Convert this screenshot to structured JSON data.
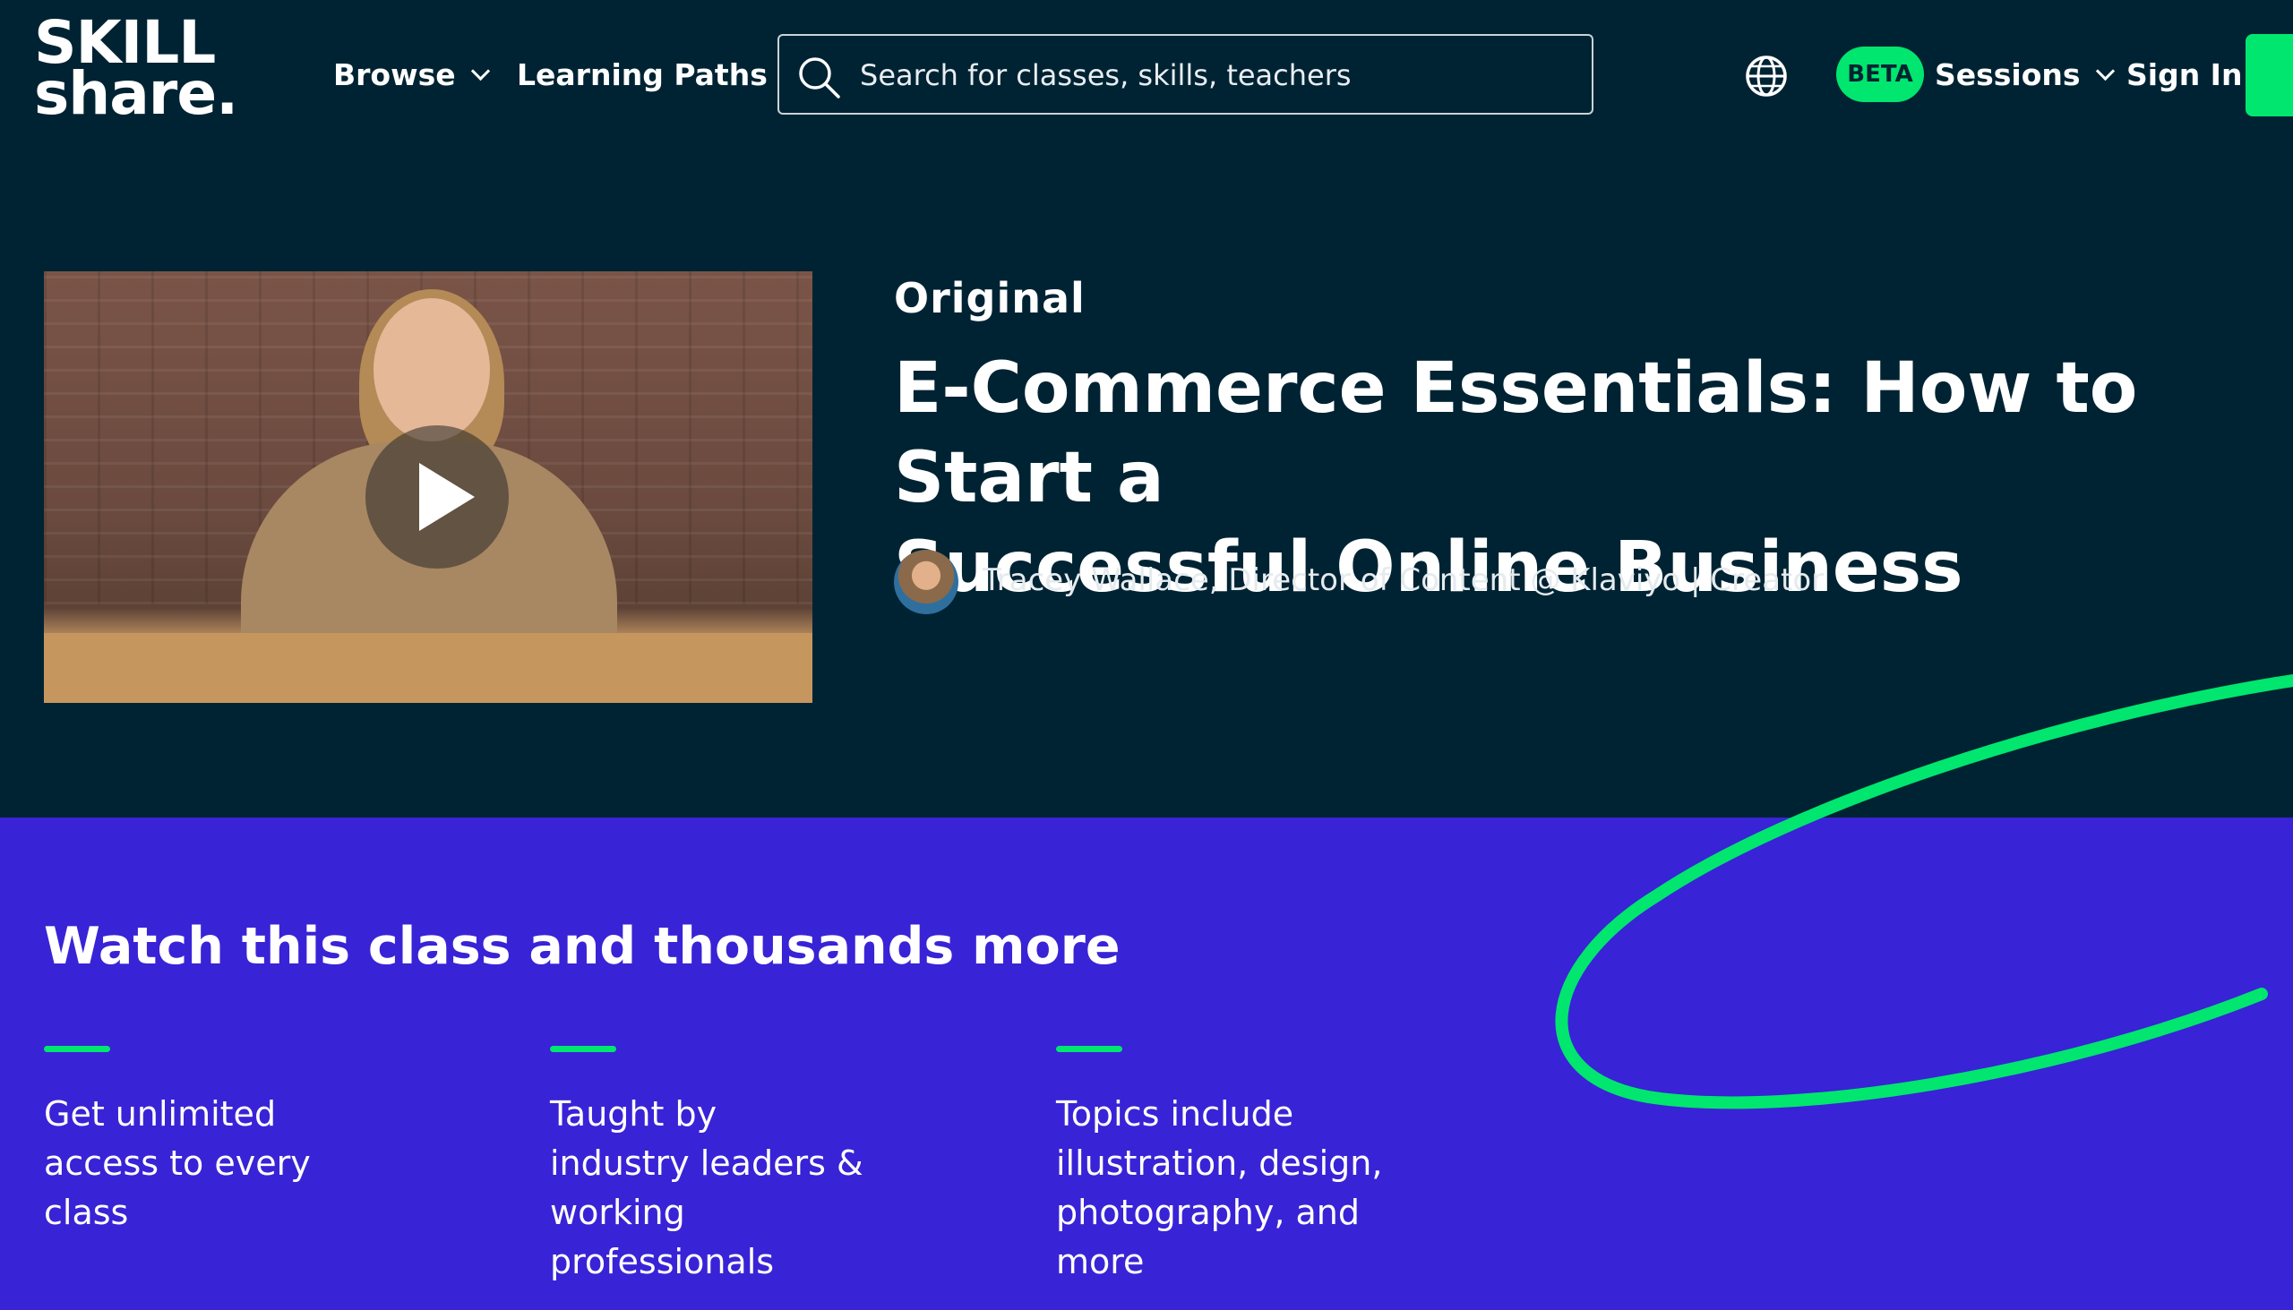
{
  "header": {
    "logo_line1": "SKILL",
    "logo_line2": "share.",
    "browse_label": "Browse",
    "learning_paths_label": "Learning Paths",
    "search_placeholder": "Search for classes, skills, teachers",
    "beta_badge": "BETA",
    "sessions_label": "Sessions",
    "sign_in_label": "Sign In"
  },
  "hero": {
    "original_label": "Original",
    "title": "E-Commerce Essentials: How to Start a\nSuccessful Online Business",
    "teacher": "Tracey Wallace, Director of Content @ Klaviyo | Creator"
  },
  "promo": {
    "heading": "Watch this class and thousands more",
    "features": [
      "Get unlimited access to every class",
      "Taught by industry leaders & working professionals",
      "Topics include illustration, design, photography, and more"
    ]
  },
  "colors": {
    "dark_bg": "#002333",
    "purple_bg": "#3923d6",
    "accent_green": "#00e66e"
  },
  "icons": [
    "search-icon",
    "globe-icon",
    "chevron-down-icon",
    "play-icon"
  ]
}
